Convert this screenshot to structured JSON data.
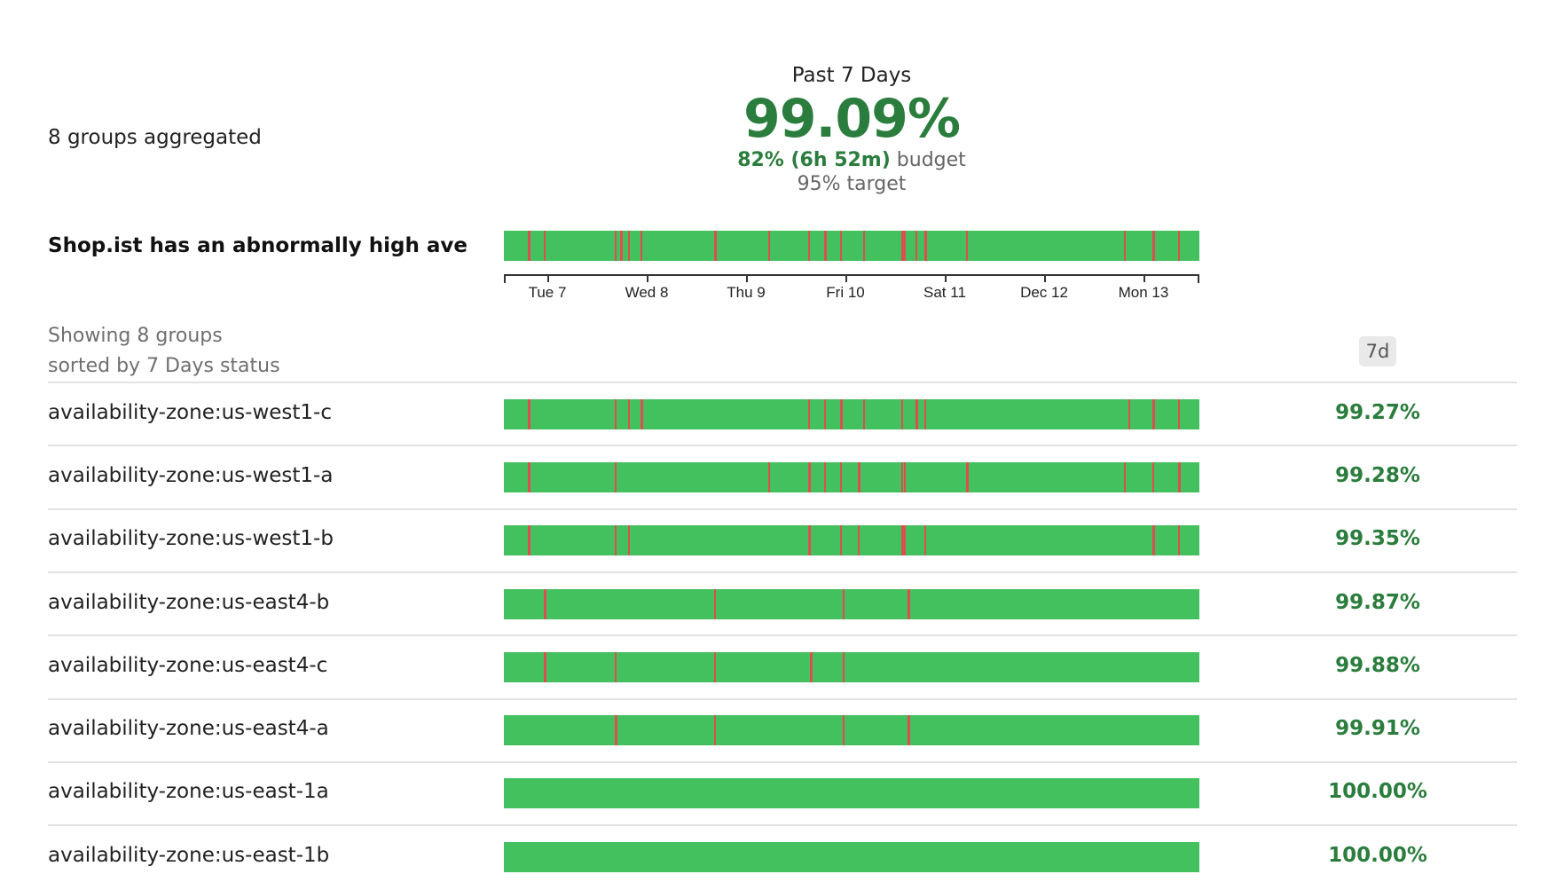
{
  "header": {
    "groups_aggregated": "8 groups aggregated",
    "range": "Past 7 Days",
    "uptime": "99.09%",
    "budget_value": "82% (6h 52m)",
    "budget_word": " budget",
    "target": "95% target"
  },
  "monitor": {
    "name": "Shop.ist has an abnormally high average latency",
    "incidents": [
      0.035,
      0.058,
      0.16,
      0.167,
      0.178,
      0.196,
      0.302,
      0.38,
      0.438,
      0.46,
      0.484,
      0.517,
      0.571,
      0.575,
      0.592,
      0.605,
      0.664,
      0.892,
      0.933,
      0.97
    ]
  },
  "axis": {
    "ticks": [
      {
        "label": "Tue 7",
        "pos": 0.0625
      },
      {
        "label": "Wed 8",
        "pos": 0.2054
      },
      {
        "label": "Thu 9",
        "pos": 0.3482
      },
      {
        "label": "Fri 10",
        "pos": 0.4911
      },
      {
        "label": "Sat 11",
        "pos": 0.6339
      },
      {
        "label": "Dec 12",
        "pos": 0.7768
      },
      {
        "label": "Mon 13",
        "pos": 0.9196
      }
    ]
  },
  "list": {
    "showing": "Showing 8 groups",
    "sorted_by": "sorted by 7 Days status",
    "period_badge": "7d"
  },
  "groups": [
    {
      "name": "availability-zone:us-west1-c",
      "value": "99.27%",
      "incidents": [
        0.035,
        0.16,
        0.178,
        0.196,
        0.438,
        0.46,
        0.484,
        0.517,
        0.571,
        0.592,
        0.605,
        0.898,
        0.933,
        0.97
      ]
    },
    {
      "name": "availability-zone:us-west1-a",
      "value": "99.28%",
      "incidents": [
        0.035,
        0.16,
        0.38,
        0.438,
        0.46,
        0.484,
        0.509,
        0.571,
        0.575,
        0.664,
        0.892,
        0.933,
        0.97
      ]
    },
    {
      "name": "availability-zone:us-west1-b",
      "value": "99.35%",
      "incidents": [
        0.035,
        0.16,
        0.178,
        0.438,
        0.484,
        0.509,
        0.571,
        0.575,
        0.605,
        0.933,
        0.97
      ]
    },
    {
      "name": "availability-zone:us-east4-b",
      "value": "99.87%",
      "incidents": [
        0.058,
        0.302,
        0.487,
        0.58
      ]
    },
    {
      "name": "availability-zone:us-east4-c",
      "value": "99.88%",
      "incidents": [
        0.058,
        0.16,
        0.302,
        0.44,
        0.487
      ]
    },
    {
      "name": "availability-zone:us-east4-a",
      "value": "99.91%",
      "incidents": [
        0.16,
        0.302,
        0.487,
        0.58
      ]
    },
    {
      "name": "availability-zone:us-east-1a",
      "value": "100.00%",
      "incidents": []
    },
    {
      "name": "availability-zone:us-east-1b",
      "value": "100.00%",
      "incidents": []
    }
  ],
  "colors": {
    "ok": "#43c15f",
    "incident": "#dd4f4f",
    "value_green": "#2a7d3c",
    "badge_bg": "#e9e9e9"
  }
}
